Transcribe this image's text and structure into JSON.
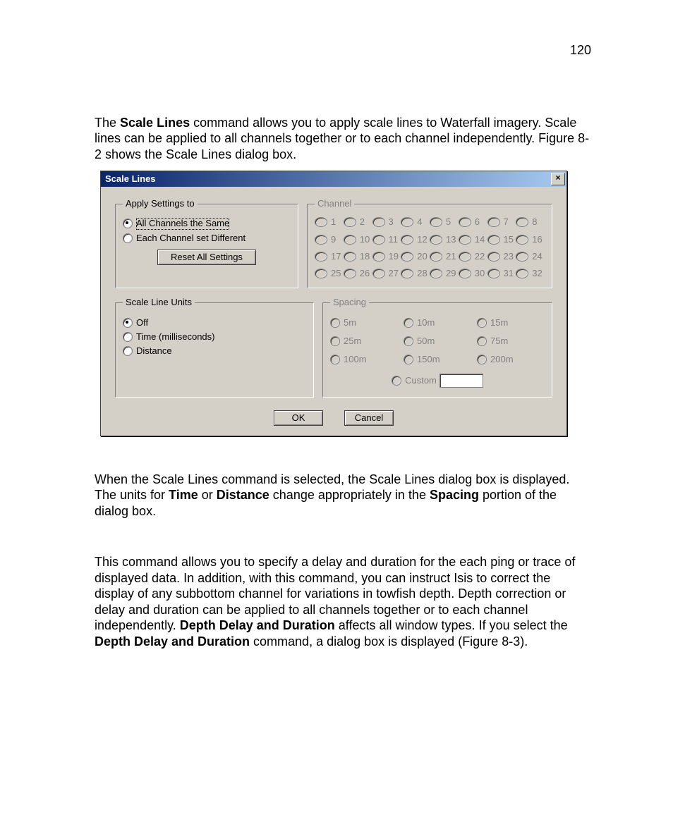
{
  "page_number": "120",
  "paragraphs": {
    "p1_a": "The ",
    "p1_b": "Scale Lines",
    "p1_c": " command allows you to apply scale lines to Waterfall imagery. Scale lines can be applied to all channels together or to each channel independently. Figure 8-2 shows the Scale Lines dialog box.",
    "p2_a": "When the Scale Lines command is selected, the Scale Lines dialog box is displayed. The units for ",
    "p2_b": "Time",
    "p2_c": " or ",
    "p2_d": "Distance",
    "p2_e": " change appropriately in the ",
    "p2_f": "Spacing",
    "p2_g": " portion of the dialog box.",
    "p3_a": "This command allows you to specify a delay and duration for the each ping or trace of displayed data. In addition, with this command, you can instruct Isis to correct the display of any subbottom channel for variations in towfish depth. Depth correction or delay and duration can be applied to all channels together or to each channel independently. ",
    "p3_b": "Depth Delay and Duration",
    "p3_c": " affects all window types. If you select the ",
    "p3_d": "Depth Delay and Duration",
    "p3_e": " command, a dialog box is displayed (Figure 8-3)."
  },
  "dialog": {
    "title": "Scale Lines",
    "close": "×",
    "apply": {
      "legend": "Apply Settings to",
      "opt_all": "All Channels the Same",
      "opt_each": "Each Channel set Different",
      "reset": "Reset All Settings"
    },
    "channel": {
      "legend": "Channel",
      "labels": [
        "1",
        "2",
        "3",
        "4",
        "5",
        "6",
        "7",
        "8",
        "9",
        "10",
        "11",
        "12",
        "13",
        "14",
        "15",
        "16",
        "17",
        "18",
        "19",
        "20",
        "21",
        "22",
        "23",
        "24",
        "25",
        "26",
        "27",
        "28",
        "29",
        "30",
        "31",
        "32"
      ]
    },
    "units": {
      "legend": "Scale Line Units",
      "off": "Off",
      "time": "Time (milliseconds)",
      "distance": "Distance"
    },
    "spacing": {
      "legend": "Spacing",
      "opts": [
        "5m",
        "10m",
        "15m",
        "25m",
        "50m",
        "75m",
        "100m",
        "150m",
        "200m"
      ],
      "custom": "Custom",
      "custom_value": ""
    },
    "ok": "OK",
    "cancel": "Cancel"
  }
}
